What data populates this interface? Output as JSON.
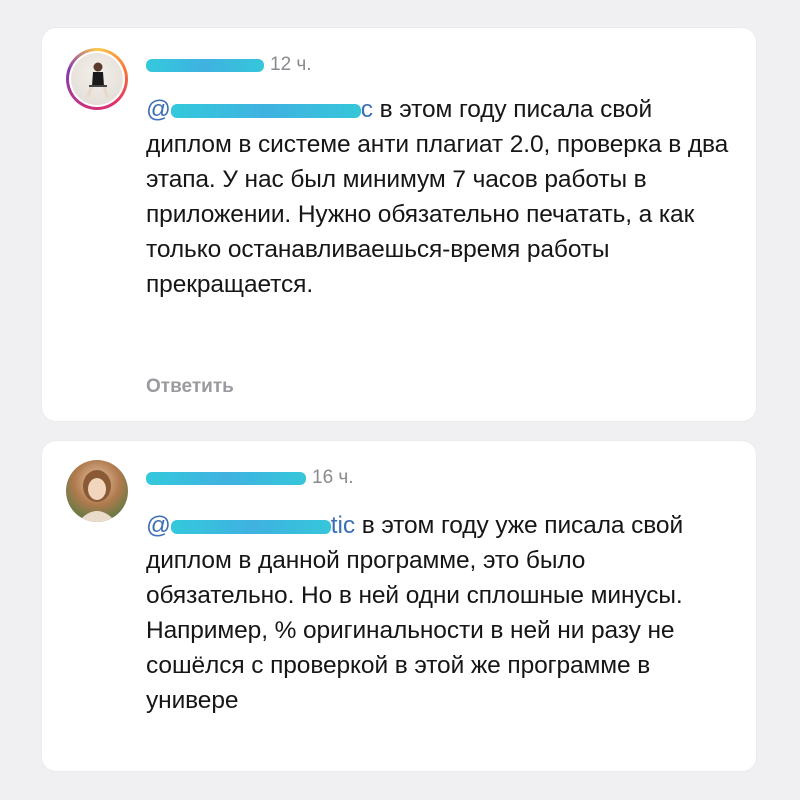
{
  "comments": [
    {
      "time": "12 ч.",
      "mention_prefix": "@",
      "mention_suffix": "c",
      "text": " в этом году писала свой диплом в системе анти плагиат 2.0, проверка в два этапа. У нас был минимум 7 часов работы в приложении. Нужно обязательно печатать, а как только останавливаешься-время работы прекращается.",
      "reply_label": "Ответить"
    },
    {
      "time": "16 ч.",
      "mention_prefix": "@",
      "mention_suffix": "tic",
      "text": " в этом году уже писала свой диплом в данной программе, это было обязательно. Но в ней одни сплошные минусы. Например, % оригинальности в ней ни разу не сошёлся с проверкой в этой же программе в универе"
    }
  ],
  "colors": {
    "background": "#f0f0f3",
    "card": "#ffffff",
    "mention": "#3b6fb6",
    "muted": "#8a8a8e",
    "redaction": "#1dc3d8"
  }
}
